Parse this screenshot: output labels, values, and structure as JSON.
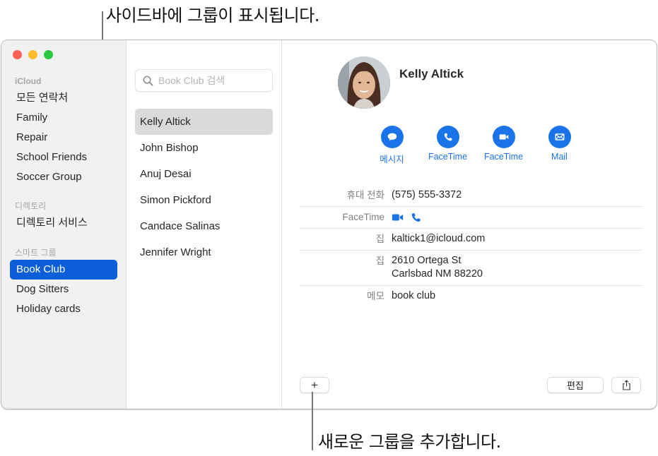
{
  "annotations": {
    "top": "사이드바에 그룹이 표시됩니다.",
    "bottom": "새로운 그룹을 추가합니다."
  },
  "sidebar": {
    "sections": [
      {
        "header": "iCloud",
        "items": [
          {
            "label": "모든 연락처",
            "selected": false
          },
          {
            "label": "Family",
            "selected": false
          },
          {
            "label": "Repair",
            "selected": false
          },
          {
            "label": "School Friends",
            "selected": false
          },
          {
            "label": "Soccer Group",
            "selected": false
          }
        ]
      },
      {
        "header": "디렉토리",
        "items": [
          {
            "label": "디렉토리 서비스",
            "selected": false
          }
        ]
      },
      {
        "header": "스마트 그룹",
        "items": [
          {
            "label": "Book Club",
            "selected": true
          },
          {
            "label": "Dog Sitters",
            "selected": false
          },
          {
            "label": "Holiday cards",
            "selected": false
          }
        ]
      }
    ]
  },
  "list": {
    "search_placeholder": "Book Club 검색",
    "search_value": "",
    "contacts": [
      {
        "name": "Kelly Altick",
        "selected": true
      },
      {
        "name": "John Bishop",
        "selected": false
      },
      {
        "name": "Anuj Desai",
        "selected": false
      },
      {
        "name": "Simon Pickford",
        "selected": false
      },
      {
        "name": "Candace Salinas",
        "selected": false
      },
      {
        "name": "Jennifer Wright",
        "selected": false
      }
    ]
  },
  "detail": {
    "name": "Kelly Altick",
    "actions": [
      {
        "label": "메시지",
        "icon": "message-icon"
      },
      {
        "label": "FaceTime",
        "icon": "phone-icon"
      },
      {
        "label": "FaceTime",
        "icon": "video-icon"
      },
      {
        "label": "Mail",
        "icon": "mail-icon"
      }
    ],
    "fields": {
      "mobile": {
        "label": "휴대 전화",
        "value": "(575) 555-3372"
      },
      "facetime": {
        "label": "FaceTime"
      },
      "email": {
        "label": "집",
        "value": "kaltick1@icloud.com"
      },
      "address": {
        "label": "집",
        "line1": "2610 Ortega St",
        "line2": "Carlsbad NM 88220"
      },
      "note": {
        "label": "메모",
        "value": "book club"
      }
    },
    "buttons": {
      "add": "+",
      "edit": "편집"
    }
  },
  "colors": {
    "accent": "#1a73e8",
    "sidebar_selected": "#0b5ed7",
    "list_selected": "#dadada"
  }
}
